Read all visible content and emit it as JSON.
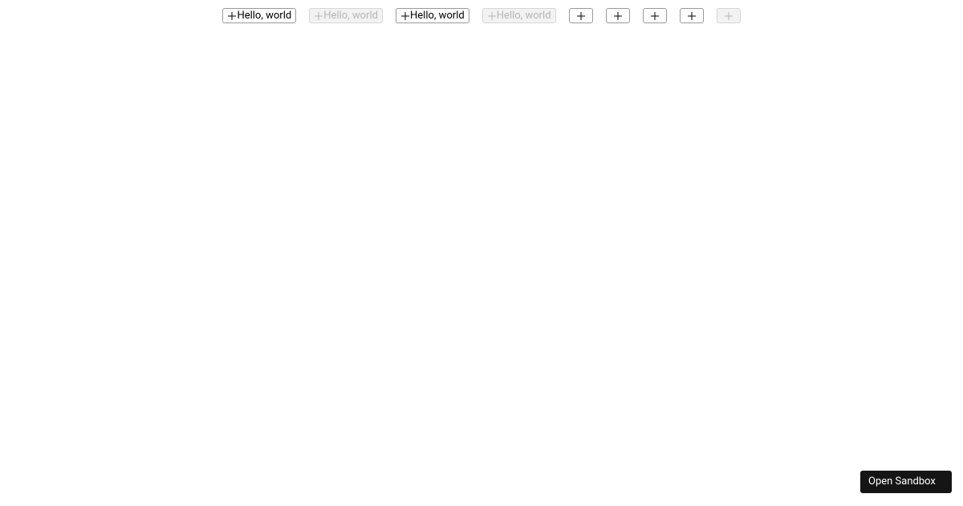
{
  "buttons": [
    {
      "label": "Hello, world",
      "icon": "plus-icon",
      "disabled": false,
      "iconOnly": false
    },
    {
      "label": "Hello, world",
      "icon": "plus-icon",
      "disabled": true,
      "iconOnly": false
    },
    {
      "label": "Hello, world",
      "icon": "plus-icon",
      "disabled": false,
      "iconOnly": false
    },
    {
      "label": "Hello, world",
      "icon": "plus-icon",
      "disabled": true,
      "iconOnly": false
    },
    {
      "label": "",
      "icon": "plus-icon",
      "disabled": false,
      "iconOnly": true
    },
    {
      "label": "",
      "icon": "plus-icon",
      "disabled": false,
      "iconOnly": true
    },
    {
      "label": "",
      "icon": "plus-icon",
      "disabled": false,
      "iconOnly": true
    },
    {
      "label": "",
      "icon": "plus-icon",
      "disabled": false,
      "iconOnly": true
    },
    {
      "label": "",
      "icon": "plus-icon",
      "disabled": true,
      "iconOnly": true
    }
  ],
  "openSandbox": {
    "label": "Open Sandbox"
  }
}
